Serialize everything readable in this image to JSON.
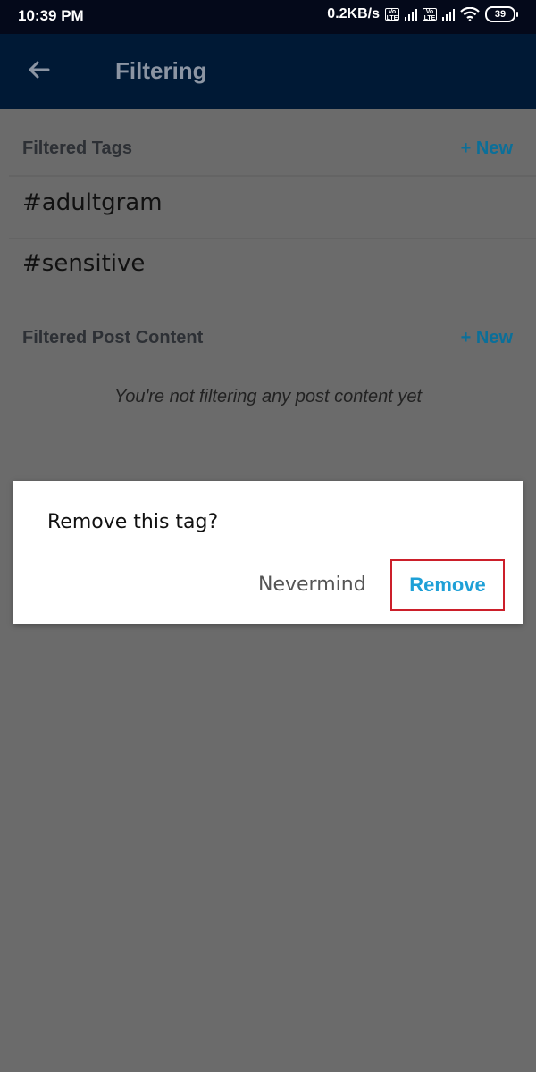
{
  "status_bar": {
    "time": "10:39 PM",
    "network_speed": "0.2KB/s",
    "volte_label": "Vo LTE",
    "battery": "39"
  },
  "app_bar": {
    "title": "Filtering"
  },
  "filtered_tags": {
    "header": "Filtered Tags",
    "new_label": "+ New",
    "items": [
      {
        "label": "#adultgram"
      },
      {
        "label": "#sensitive"
      }
    ]
  },
  "filtered_post_content": {
    "header": "Filtered Post Content",
    "new_label": "+ New",
    "empty_message": "You're not filtering any post content yet"
  },
  "dialog": {
    "message": "Remove this tag?",
    "cancel_label": "Nevermind",
    "confirm_label": "Remove"
  },
  "colors": {
    "status_bar_bg": "#04091a",
    "app_bar_bg": "#001935",
    "accent": "#1ea0d7",
    "highlight_border": "#cc1f2a"
  }
}
